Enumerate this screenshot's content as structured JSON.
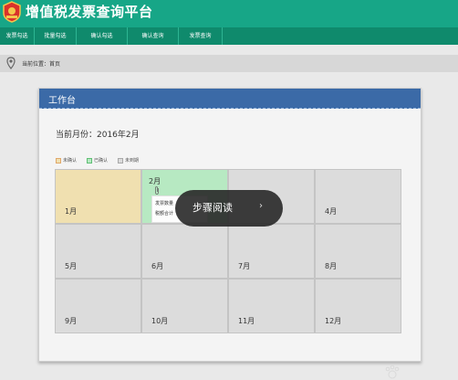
{
  "app": {
    "title": "增值税发票查询平台"
  },
  "nav": {
    "items": [
      {
        "label": "发票勾选"
      },
      {
        "label": "批量勾选"
      },
      {
        "label": "确认勾选"
      },
      {
        "label": "确认查询"
      },
      {
        "label": "发票查询"
      }
    ]
  },
  "breadcrumb": {
    "text": "当前位置：首页"
  },
  "panel": {
    "title": "工作台",
    "current_month": "当前月份：2016年2月"
  },
  "legend": [
    {
      "label": "未确认",
      "color": "#f0e0b0",
      "border": "#e0a86a"
    },
    {
      "label": "已确认",
      "color": "#b7e9c2",
      "border": "#5fbf74"
    },
    {
      "label": "未到期",
      "color": "#dcdcdc",
      "border": "#a8a8a8"
    }
  ],
  "months": [
    {
      "label": "1月",
      "status": "unconfirmed"
    },
    {
      "label": "2月",
      "status": "confirmed"
    },
    {
      "label": "",
      "status": "pending"
    },
    {
      "label": "4月",
      "status": "pending"
    },
    {
      "label": "5月",
      "status": "pending"
    },
    {
      "label": "6月",
      "status": "pending"
    },
    {
      "label": "7月",
      "status": "pending"
    },
    {
      "label": "8月",
      "status": "pending"
    },
    {
      "label": "9月",
      "status": "pending"
    },
    {
      "label": "10月",
      "status": "pending"
    },
    {
      "label": "11月",
      "status": "pending"
    },
    {
      "label": "12月",
      "status": "pending"
    }
  ],
  "popup": {
    "line1": "发票数量",
    "line2": "税额合计"
  },
  "tooltip": {
    "text": "步骤阅读",
    "arrow": "›"
  },
  "icons": {
    "logo": "tax-emblem-icon",
    "location": "location-pin-icon",
    "attachment": "paperclip-icon",
    "watermark": "paw-watermark-icon"
  },
  "colors": {
    "brand": "#17a687",
    "nav": "#0f8a6c",
    "panel_header": "#3b6aa7"
  }
}
